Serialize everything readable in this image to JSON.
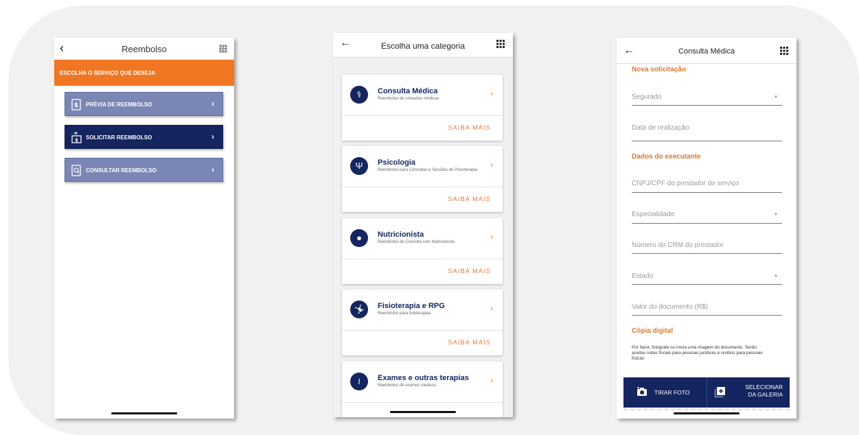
{
  "screen1": {
    "title": "Reembolso",
    "banner": "ESCOLHA O SERVIÇO QUE DESEJA",
    "menu": [
      {
        "label": "PRÉVIA DE REEMBOLSO",
        "icon": "dollar-document-icon",
        "active": false
      },
      {
        "label": "SOLICITAR REEMBOLSO",
        "icon": "cash-transfer-icon",
        "active": true
      },
      {
        "label": "CONSULTAR REEMBOLSO",
        "icon": "search-document-icon",
        "active": false
      }
    ]
  },
  "screen2": {
    "title": "Escolha uma categoria",
    "more_label": "SAIBA MAIS",
    "categories": [
      {
        "title": "Consulta Médica",
        "subtitle": "Reembolso de consultas médicas",
        "icon": "doctor-icon"
      },
      {
        "title": "Psicologia",
        "subtitle": "Reembolso para Consultas e Sessões de Psicoterapia",
        "icon": "psi-icon"
      },
      {
        "title": "Nutricionista",
        "subtitle": "Reembolso de Consulta com Nutricionista",
        "icon": "apple-icon"
      },
      {
        "title": "Fisioterapia e RPG",
        "subtitle": "Reembolso para fisioterapias",
        "icon": "stretching-icon"
      },
      {
        "title": "Exames e outras terapias",
        "subtitle": "Reembolso de exames médicos",
        "icon": "dna-icon"
      }
    ]
  },
  "screen3": {
    "title": "Consulta Médica",
    "section_new": "Nova solicitação",
    "insured_placeholder": "Segurado",
    "date_placeholder": "Data de realização",
    "section_executor": "Dados do executante",
    "cnpj_placeholder": "CNPJ/CPF do prestador do serviço",
    "specialty_placeholder": "Especialidade",
    "crm_placeholder": "Número do CRM do prestador",
    "state_placeholder": "Estado",
    "value_placeholder": "Valor do documento (R$)",
    "section_copy": "Cópia digital",
    "help_text": "Por favor, fotografe ou insira uma imagem do documento. Serão aceitas notas fiscais para pessoas jurídicas e recibos para pessoas físicas",
    "take_photo": "TIRAR FOTO",
    "gallery_line1": "SELECIONAR",
    "gallery_line2": "DA GALERIA"
  },
  "colors": {
    "orange": "#f07622",
    "navy": "#14255f",
    "lavender": "#7a87b5"
  }
}
